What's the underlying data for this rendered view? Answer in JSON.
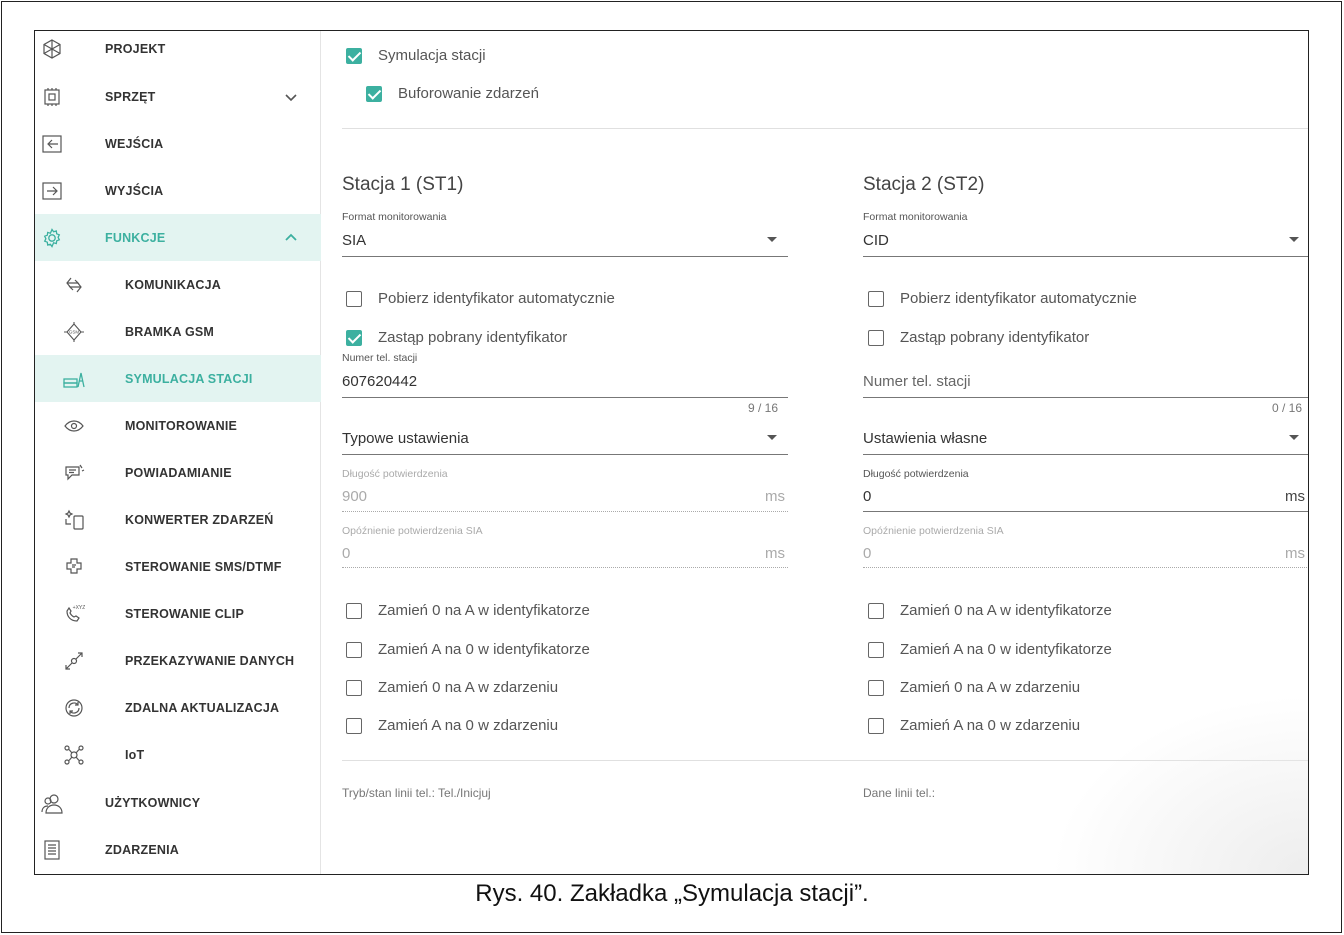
{
  "sidebar": {
    "items": [
      {
        "label": "PROJEKT",
        "icon": "project-icon"
      },
      {
        "label": "SPRZĘT",
        "icon": "hardware-icon"
      },
      {
        "label": "WEJŚCIA",
        "icon": "inputs-icon"
      },
      {
        "label": "WYJŚCIA",
        "icon": "outputs-icon"
      },
      {
        "label": "FUNKCJE",
        "icon": "functions-icon"
      },
      {
        "label": "KOMUNIKACJA",
        "icon": "communication-icon"
      },
      {
        "label": "BRAMKA GSM",
        "icon": "gsm-gateway-icon"
      },
      {
        "label": "SYMULACJA STACJI",
        "icon": "station-simulation-icon"
      },
      {
        "label": "MONITOROWANIE",
        "icon": "monitoring-icon"
      },
      {
        "label": "POWIADAMIANIE",
        "icon": "notification-icon"
      },
      {
        "label": "KONWERTER ZDARZEŃ",
        "icon": "event-converter-icon"
      },
      {
        "label": "STEROWANIE SMS/DTMF",
        "icon": "sms-dtmf-control-icon"
      },
      {
        "label": "STEROWANIE CLIP",
        "icon": "clip-control-icon"
      },
      {
        "label": "PRZEKAZYWANIE DANYCH",
        "icon": "data-transfer-icon"
      },
      {
        "label": "ZDALNA AKTUALIZACJA",
        "icon": "remote-update-icon"
      },
      {
        "label": "IoT",
        "icon": "iot-icon"
      },
      {
        "label": "UŻYTKOWNICY",
        "icon": "users-icon"
      },
      {
        "label": "ZDARZENIA",
        "icon": "events-icon"
      }
    ]
  },
  "main": {
    "station_simulation": {
      "label": "Symulacja stacji",
      "checked": true
    },
    "event_buffering": {
      "label": "Buforowanie zdarzeń",
      "checked": true
    },
    "station1": {
      "title": "Stacja 1 (ST1)",
      "format_label": "Format monitorowania",
      "format_value": "SIA",
      "auto_id": {
        "label": "Pobierz identyfikator automatycznie",
        "checked": false
      },
      "replace_id": {
        "label": "Zastąp pobrany identyfikator",
        "checked": true
      },
      "phone_label": "Numer tel. stacji",
      "phone_value": "607620442",
      "phone_counter": "9 / 16",
      "settings_value": "Typowe ustawienia",
      "ack_length_label": "Długość potwierdzenia",
      "ack_length_value": "900",
      "ack_length_unit": "ms",
      "sia_delay_label": "Opóźnienie potwierdzenia SIA",
      "sia_delay_value": "0",
      "sia_delay_unit": "ms",
      "options": [
        {
          "label": "Zamień 0 na A w identyfikatorze",
          "checked": false
        },
        {
          "label": "Zamień A na 0 w identyfikatorze",
          "checked": false
        },
        {
          "label": "Zamień 0 na A w zdarzeniu",
          "checked": false
        },
        {
          "label": "Zamień A na 0 w zdarzeniu",
          "checked": false
        }
      ],
      "footer": "Tryb/stan linii tel.: Tel./Inicjuj"
    },
    "station2": {
      "title": "Stacja 2 (ST2)",
      "format_label": "Format monitorowania",
      "format_value": "CID",
      "auto_id": {
        "label": "Pobierz identyfikator automatycznie",
        "checked": false
      },
      "replace_id": {
        "label": "Zastąp pobrany identyfikator",
        "checked": false
      },
      "phone_placeholder": "Numer tel. stacji",
      "phone_counter": "0 / 16",
      "settings_value": "Ustawienia własne",
      "ack_length_label": "Długość potwierdzenia",
      "ack_length_value": "0",
      "ack_length_unit": "ms",
      "sia_delay_label": "Opóźnienie potwierdzenia SIA",
      "sia_delay_value": "0",
      "sia_delay_unit": "ms",
      "options": [
        {
          "label": "Zamień 0 na A w identyfikatorze",
          "checked": false
        },
        {
          "label": "Zamień A na 0 w identyfikatorze",
          "checked": false
        },
        {
          "label": "Zamień 0 na A w zdarzeniu",
          "checked": false
        },
        {
          "label": "Zamień A na 0 w zdarzeniu",
          "checked": false
        }
      ],
      "footer": "Dane linii tel.:"
    }
  },
  "caption": "Rys. 40. Zakładka „Symulacja stacji”.",
  "colors": {
    "accent": "#3cb0a0",
    "active_bg": "#e3f4f1"
  }
}
